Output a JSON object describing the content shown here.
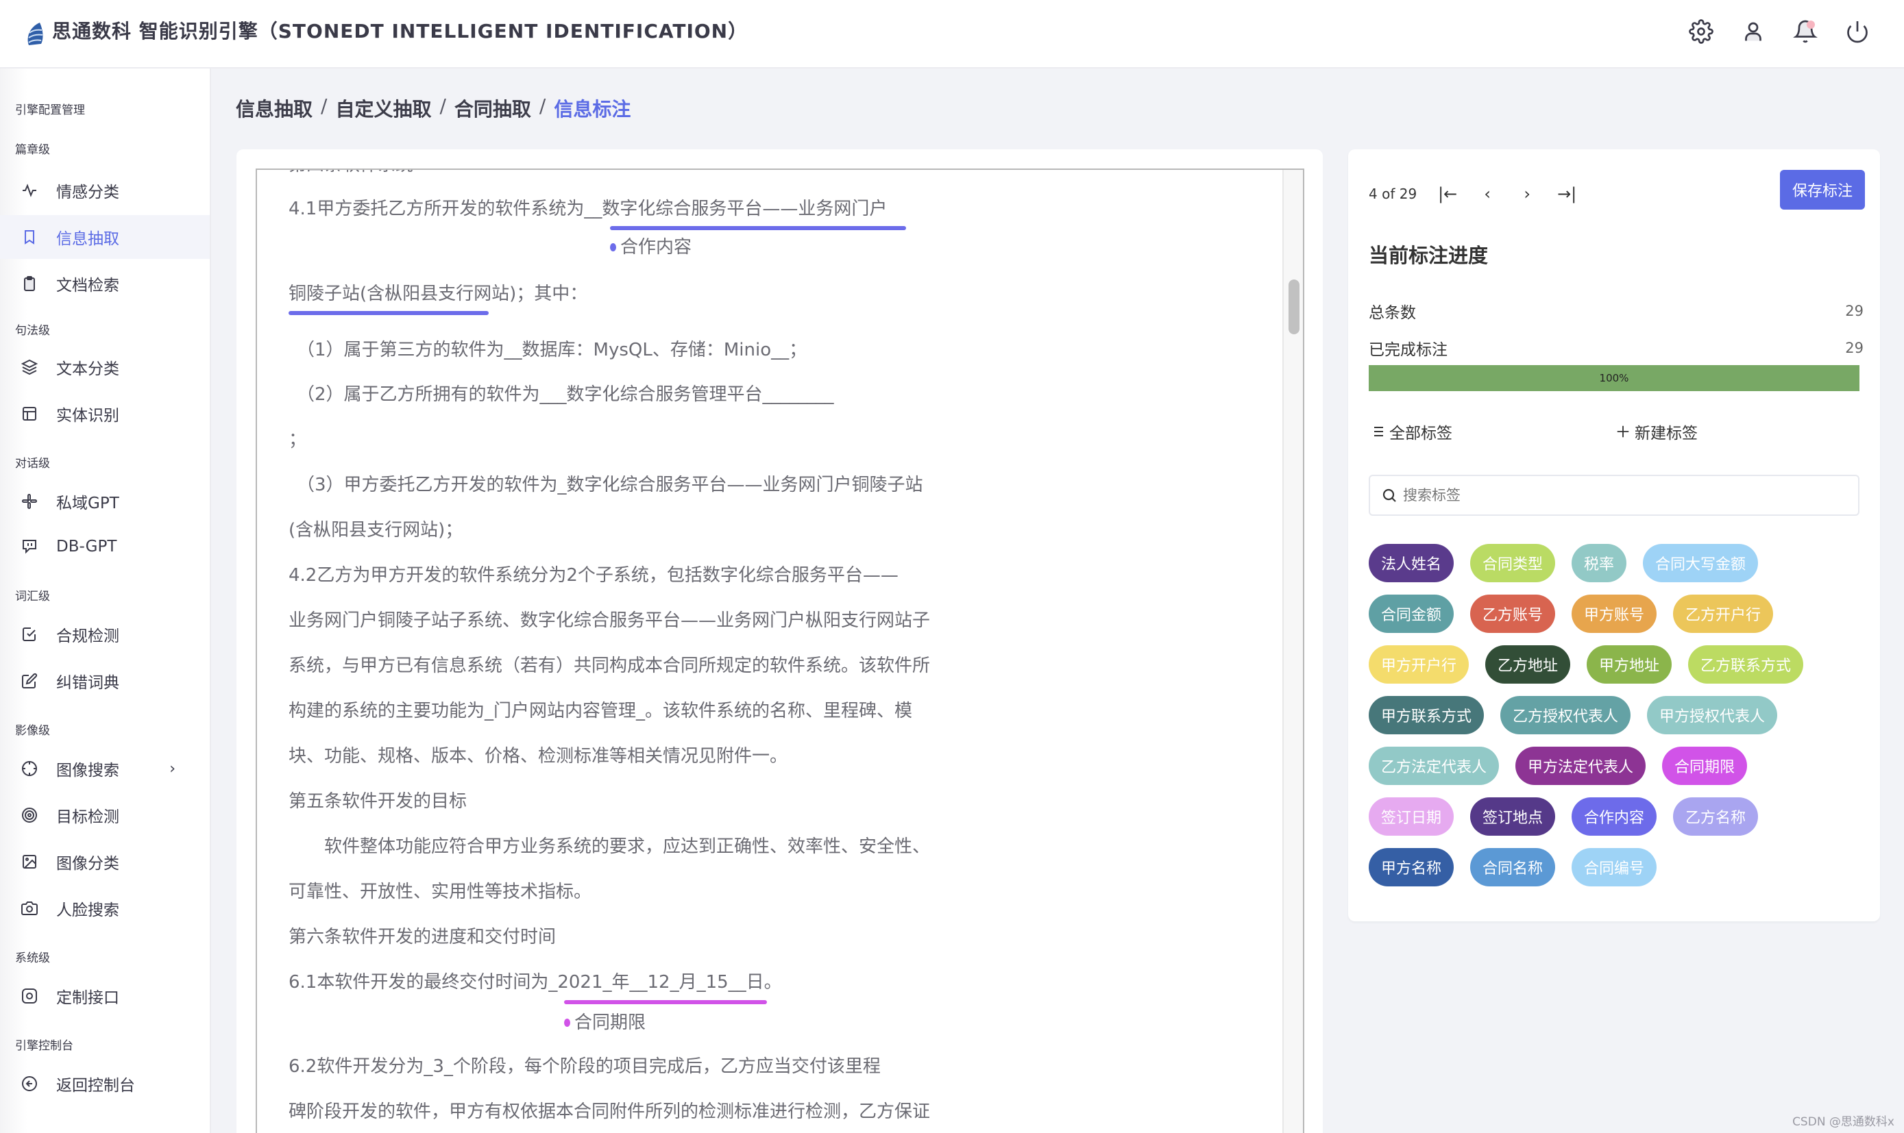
{
  "header": {
    "title": "思通数科 智能识别引擎（STONEDT INTELLIGENT IDENTIFICATION）",
    "icons": [
      "settings-icon",
      "user-icon",
      "bell-icon",
      "power-icon"
    ]
  },
  "sidebar": {
    "groups": [
      {
        "label": "引擎配置管理",
        "items": []
      },
      {
        "label": "篇章级",
        "items": [
          {
            "label": "情感分类",
            "icon": "activity-icon",
            "active": false
          },
          {
            "label": "信息抽取",
            "icon": "bookmark-icon",
            "active": true
          },
          {
            "label": "文档检索",
            "icon": "clipboard-icon",
            "active": false
          }
        ]
      },
      {
        "label": "句法级",
        "items": [
          {
            "label": "文本分类",
            "icon": "layers-icon",
            "active": false
          },
          {
            "label": "实体识别",
            "icon": "layout-icon",
            "active": false
          }
        ]
      },
      {
        "label": "对话级",
        "items": [
          {
            "label": "私域GPT",
            "icon": "slack-icon",
            "active": false
          },
          {
            "label": "DB-GPT",
            "icon": "chat-icon",
            "active": false
          }
        ]
      },
      {
        "label": "词汇级",
        "items": [
          {
            "label": "合规检测",
            "icon": "check-square-icon",
            "active": false
          },
          {
            "label": "纠错词典",
            "icon": "edit-icon",
            "active": false
          }
        ]
      },
      {
        "label": "影像级",
        "items": [
          {
            "label": "图像搜索",
            "icon": "crosshair-icon",
            "active": false,
            "has_submenu": true
          },
          {
            "label": "目标检测",
            "icon": "target-icon",
            "active": false
          },
          {
            "label": "图像分类",
            "icon": "image-icon",
            "active": false
          },
          {
            "label": "人脸搜索",
            "icon": "camera-icon",
            "active": false
          }
        ]
      },
      {
        "label": "系统级",
        "items": [
          {
            "label": "定制接口",
            "icon": "instagram-icon",
            "active": false
          }
        ]
      },
      {
        "label": "引擎控制台",
        "items": [
          {
            "label": "返回控制台",
            "icon": "arrow-left-circle-icon",
            "active": false
          }
        ]
      }
    ],
    "chevron": "›"
  },
  "breadcrumb": {
    "items": [
      "信息抽取",
      "自定义抽取",
      "合同抽取"
    ],
    "current": "信息标注",
    "separator": "/"
  },
  "document": {
    "clipped_line": "第四条软件系统",
    "lines": [
      "4.1甲方委托乙方所开发的软件系统为__数字化综合服务平台——业务网门户",
      "铜陵子站(含枞阳县支行网站)；其中：",
      "（1）属于第三方的软件为__数据库：MysQL、存储：Minio__；",
      "（2）属于乙方所拥有的软件为___数字化综合服务管理平台________",
      "；",
      "（3）甲方委托乙方开发的软件为_数字化综合服务平台——业务网门户铜陵子站",
      "(含枞阳县支行网站)；",
      "4.2乙方为甲方开发的软件系统分为2个子系统，包括数字化综合服务平台——",
      "业务网门户铜陵子站子系统、数字化综合服务平台——业务网门户枞阳支行网站子",
      "系统，与甲方已有信息系统（若有）共同构成本合同所规定的软件系统。该软件所",
      "构建的系统的主要功能为_门户网站内容管理_。该软件系统的名称、里程碑、模",
      "块、功能、规格、版本、价格、检测标准等相关情况见附件一。",
      "第五条软件开发的目标",
      "　　软件整体功能应符合甲方业务系统的要求，应达到正确性、效率性、安全性、",
      "可靠性、开放性、实用性等技术指标。",
      "第六条软件开发的进度和交付时间",
      "6.1本软件开发的最终交付时间为_2021_年__12_月_15__日。",
      "6.2软件开发分为_3_个阶段，每个阶段的项目完成后，乙方应当交付该里程",
      "碑阶段开发的软件，甲方有权依据本合同附件所列的检测标准进行检测，乙方保证"
    ],
    "annotations": [
      {
        "label": "合作内容",
        "color": "#6c6cea",
        "text": "数字化综合服务平台——业务网门户铜陵子站(含枞阳县支行网站)"
      },
      {
        "label": "合同期限",
        "color": "#d153e8",
        "text": "2021_年__12_月_15__日"
      }
    ]
  },
  "panel": {
    "pager": {
      "current": 4,
      "total": 29,
      "text": "4 of 29",
      "first": "|←",
      "prev": "‹",
      "next": "›",
      "last": "→|"
    },
    "save_label": "保存标注",
    "progress_title": "当前标注进度",
    "total_label": "总条数",
    "total_value": "29",
    "done_label": "已完成标注",
    "done_value": "29",
    "progress_percent": 100,
    "progress_text": "100%",
    "progress_color": "#78a865",
    "all_tags_label": "全部标签",
    "new_tag_label": "新建标签",
    "search_placeholder": "搜索标签",
    "tag_rows": [
      [
        {
          "label": "法人姓名",
          "color": "#5a3b8c"
        },
        {
          "label": "合同类型",
          "color": "#badb64"
        },
        {
          "label": "税率",
          "color": "#92c9c6"
        },
        {
          "label": "合同大写金额",
          "color": "#9ed3f6"
        }
      ],
      [
        {
          "label": "合同金额",
          "color": "#5fa0a4"
        },
        {
          "label": "乙方账号",
          "color": "#d86450"
        },
        {
          "label": "甲方账号",
          "color": "#e7a54d"
        },
        {
          "label": "乙方开户行",
          "color": "#ecc65a"
        }
      ],
      [
        {
          "label": "甲方开户行",
          "color": "#f4dc6c"
        },
        {
          "label": "乙方地址",
          "color": "#324e37"
        },
        {
          "label": "甲方地址",
          "color": "#8bb54b"
        },
        {
          "label": "乙方联系方式",
          "color": "#bcdb62"
        }
      ],
      [
        {
          "label": "甲方联系方式",
          "color": "#47777a"
        },
        {
          "label": "乙方授权代表人",
          "color": "#64a2a5"
        },
        {
          "label": "甲方授权代表人",
          "color": "#92c9c7"
        }
      ],
      [
        {
          "label": "乙方法定代表人",
          "color": "#92c9c7"
        },
        {
          "label": "甲方法定代表人",
          "color": "#8d3494"
        },
        {
          "label": "合同期限",
          "color": "#d153e8"
        }
      ],
      [
        {
          "label": "签订日期",
          "color": "#e6aaf0"
        },
        {
          "label": "签订地点",
          "color": "#553989"
        },
        {
          "label": "合作内容",
          "color": "#6d6bea"
        },
        {
          "label": "乙方名称",
          "color": "#a9a5f0"
        }
      ],
      [
        {
          "label": "甲方名称",
          "color": "#355fa5"
        },
        {
          "label": "合同名称",
          "color": "#5b99d5"
        },
        {
          "label": "合同编号",
          "color": "#9ed3f6"
        }
      ]
    ]
  },
  "watermark": "CSDN @思通数科x",
  "colors": {
    "accent": "#5b6be5",
    "background": "#f2f3f7"
  }
}
